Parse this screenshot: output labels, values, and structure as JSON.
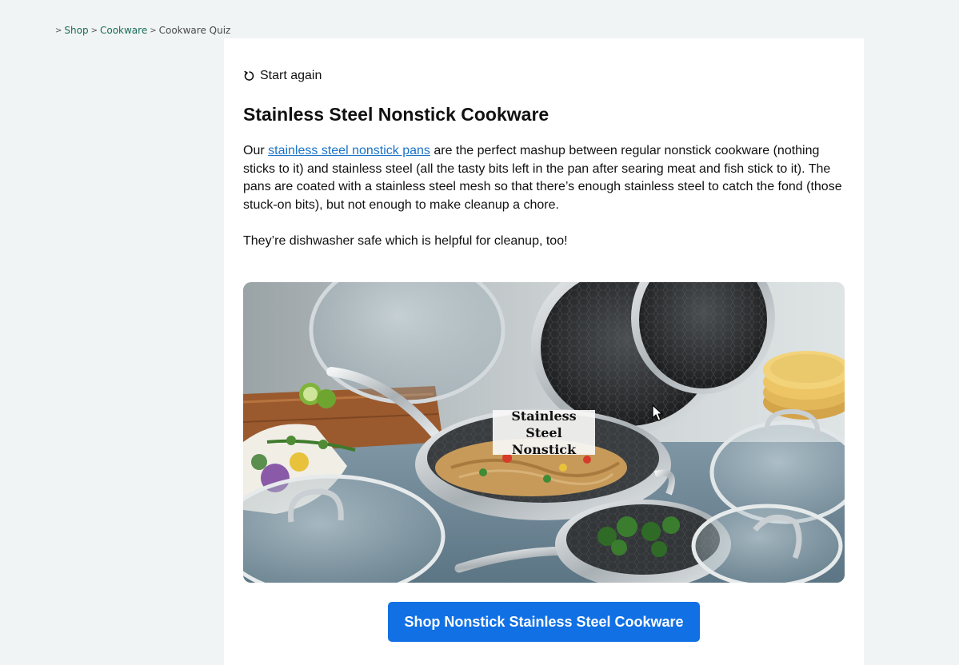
{
  "breadcrumb": {
    "separator": ">",
    "items": [
      "Shop",
      "Cookware"
    ],
    "current": "Cookware Quiz"
  },
  "start_again": {
    "label": "Start again",
    "icon": "restart-icon"
  },
  "product": {
    "title": "Stainless Steel Nonstick Cookware",
    "desc_before": "Our ",
    "desc_link": "stainless steel nonstick pans",
    "desc_after": " are the perfect mashup between regular nonstick cookware (nothing sticks to it) and stainless steel (all the tasty bits left in the pan after searing meat and fish stick to it). The pans are coated with a stainless steel mesh so that there’s enough stainless steel to catch the fond (those stuck-on bits), but not enough to make cleanup a chore.",
    "desc2": "They’re dishwasher safe which is helpful for cleanup, too!",
    "image_label_line1": "Stainless Steel",
    "image_label_line2": "Nonstick",
    "cta": "Shop Nonstick Stainless Steel Cookware"
  },
  "colors": {
    "page_bg": "#f0f4f4",
    "link": "#1a73c8",
    "breadcrumb_link": "#1a6b5a",
    "cta_bg": "#1170e4"
  }
}
